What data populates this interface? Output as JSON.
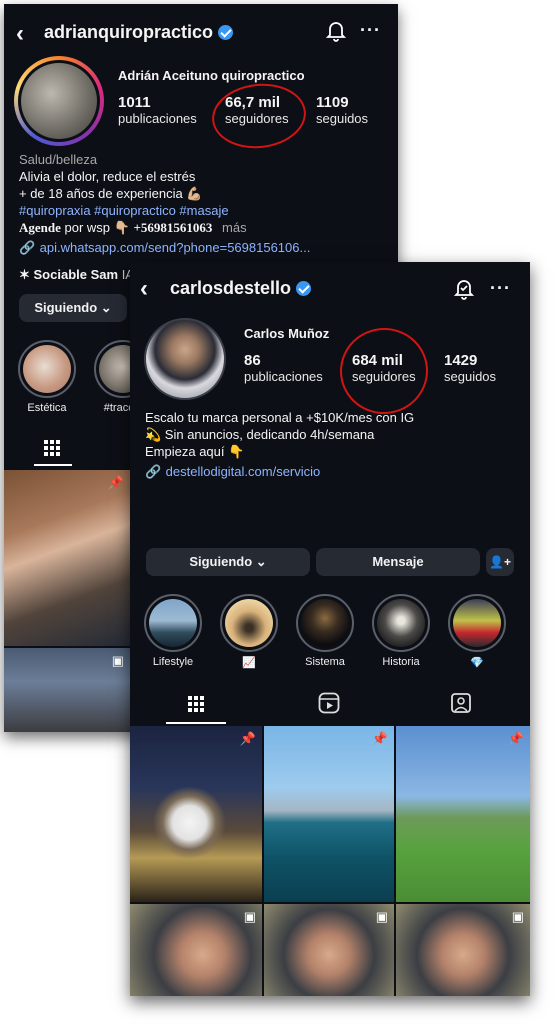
{
  "back_profile": {
    "username": "adrianquiropractico",
    "full_name": "Adrián Aceituno quiropractico",
    "stats": [
      {
        "value": "1011",
        "label": "publicaciones"
      },
      {
        "value": "66,7 mil",
        "label": "seguidores"
      },
      {
        "value": "1109",
        "label": "seguidos"
      }
    ],
    "category": "Salud/belleza",
    "bio_line1": "Alivia el dolor, reduce el estrés",
    "bio_line2": "+ de 18 años de experiencia 💪🏼",
    "hashtags": "#quiropraxia #quiropractico #masaje",
    "bio_agende_bold": "Agende",
    "bio_agende_rest": "por wsp 👇🏼",
    "bio_phone": "+56981561063",
    "bio_more": "más",
    "link": "api.whatsapp.com/send?phone=5698156106...",
    "mention": "Sociable Sam",
    "mention_rest": "IA",
    "follow_button": "Siguiendo",
    "highlights": [
      {
        "label": "Estética"
      },
      {
        "label": "#traccio"
      }
    ]
  },
  "front_profile": {
    "username": "carlosdestello",
    "full_name": "Carlos Muñoz",
    "stats": [
      {
        "value": "86",
        "label": "publicaciones"
      },
      {
        "value": "684 mil",
        "label": "seguidores"
      },
      {
        "value": "1429",
        "label": "seguidos"
      }
    ],
    "bio_line1": "Escalo tu marca personal a +$10K/mes con IG",
    "bio_line2": "💫 Sin anuncios, dedicando 4h/semana",
    "bio_line3": "Empieza aquí 👇",
    "link": "destellodigital.com/servicio",
    "follow_button": "Siguiendo",
    "message_button": "Mensaje",
    "highlights": [
      {
        "label": "Lifestyle"
      },
      {
        "label": "📈"
      },
      {
        "label": "Sistema"
      },
      {
        "label": "Historia"
      },
      {
        "label": "💎"
      }
    ]
  },
  "icons": {
    "back": "chevron-left-icon",
    "bell": "bell-icon",
    "more": "more-icon",
    "link": "link-icon",
    "add_user": "add-user-icon",
    "grid": "grid-icon",
    "reels": "reels-icon",
    "tagged": "tagged-icon",
    "pin": "pin-icon"
  },
  "colors": {
    "background": "#0c0f15",
    "accent_link": "#8fb4ff",
    "verified": "#3897f0",
    "annotation_circle": "#d01515"
  }
}
